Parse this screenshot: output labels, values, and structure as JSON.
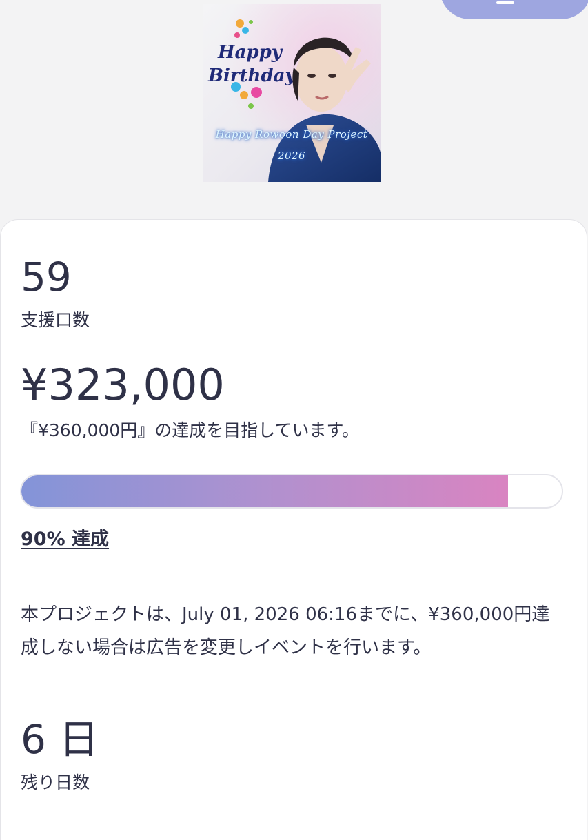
{
  "hero": {
    "line1": "Happy Rowoon Day Project",
    "line2": "2026",
    "greeting": "Happy Birthday!"
  },
  "stats": {
    "supporters_value": "59",
    "supporters_label": "支援口数",
    "amount_value": "¥323,000",
    "goal_text": "『¥360,000円』の達成を目指しています。",
    "progress_fraction": 0.9,
    "achieved_text": "90% 達成",
    "notice_text": "本プロジェクトは、July 01, 2026 06:16までに、¥360,000円達成しない場合は広告を変更しイベントを行います。",
    "days_value": "6 日",
    "days_label": "残り日数"
  },
  "colors": {
    "progress_start": "#8394d8",
    "progress_end": "#d984c1",
    "text": "#2f3147",
    "accent_pill": "#9ea6e0"
  }
}
